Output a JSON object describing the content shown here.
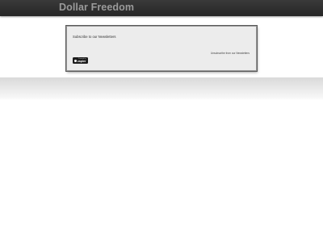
{
  "site": {
    "title": "Dollar Freedom"
  },
  "newsletter": {
    "heading": "Subscribe to our Newsletters",
    "unsubscribe_label": "Unsubscribe from our Newsletters",
    "badge_small": "Powered by",
    "badge_main": "zapier"
  },
  "colors": {
    "top_bar": "#2b2b2b",
    "title_text": "#9a9a9a",
    "card_background": "#ececec",
    "badge_background": "#1c1c1c"
  }
}
